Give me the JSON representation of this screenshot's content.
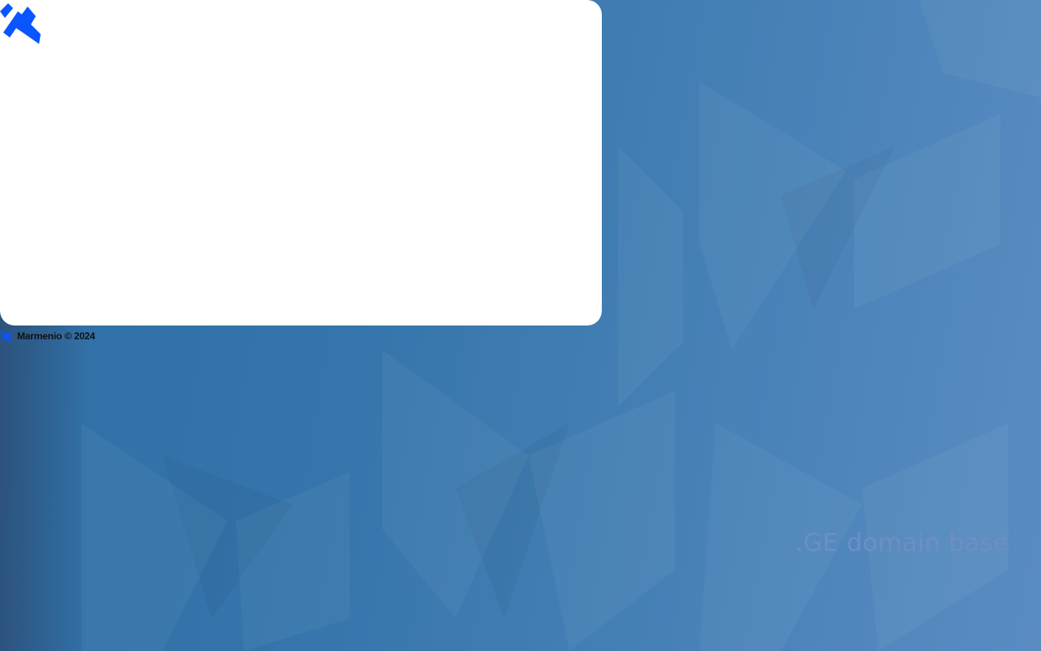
{
  "footer": {
    "copyright": "Marmenio © 2024"
  },
  "caption": {
    "domain_base": ".GE domain base"
  },
  "icons": {
    "logo": "marmenio-logo-icon",
    "footer_logo": "marmenio-small-logo-icon"
  },
  "colors": {
    "brand_blue": "#0a55ff",
    "background": "#3575ab",
    "card": "#ffffff",
    "caption": "#6f8ec4"
  }
}
